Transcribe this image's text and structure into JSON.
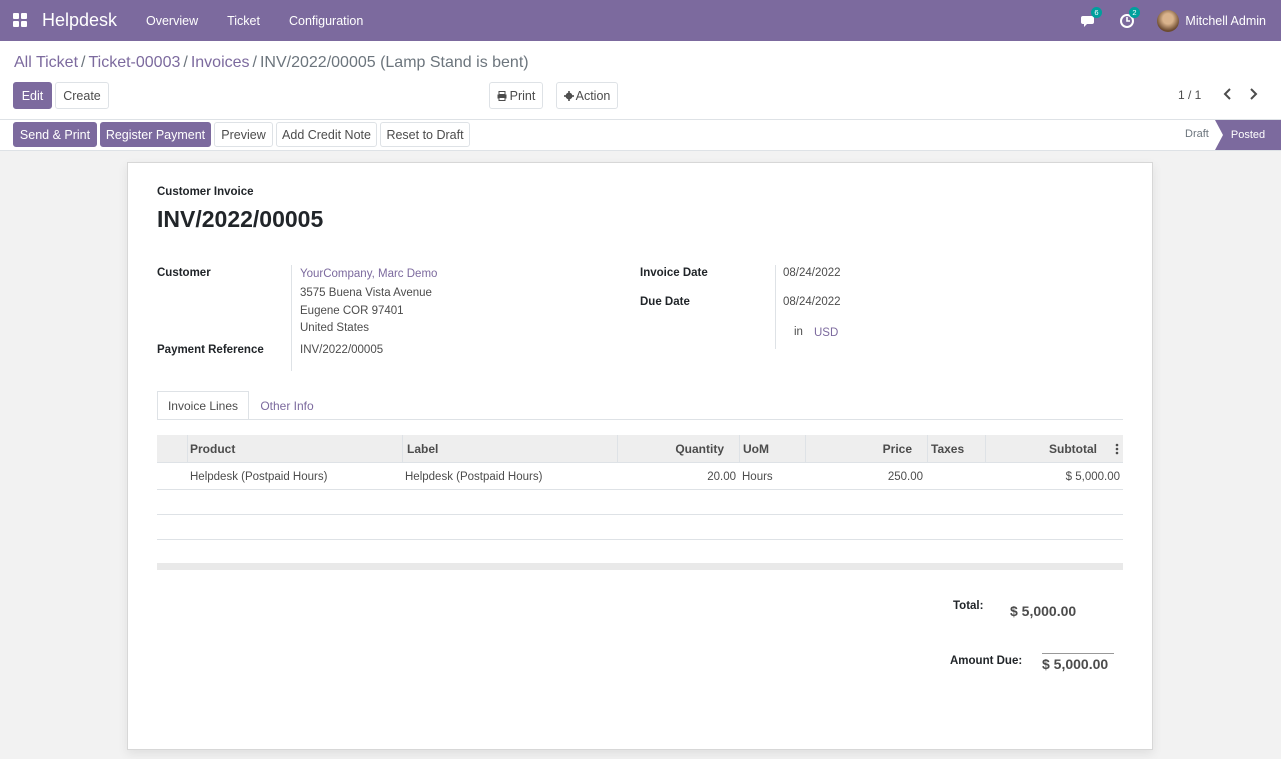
{
  "navbar": {
    "app_name": "Helpdesk",
    "menu": [
      "Overview",
      "Ticket",
      "Configuration"
    ],
    "messages_count": "6",
    "activities_count": "2",
    "user_name": "Mitchell Admin",
    "color": "#7c6a9e"
  },
  "breadcrumb": {
    "items": [
      "All Ticket",
      "Ticket-00003",
      "Invoices"
    ],
    "current": "INV/2022/00005 (Lamp Stand is bent)"
  },
  "control": {
    "edit_label": "Edit",
    "create_label": "Create",
    "print_label": "Print",
    "action_label": "Action",
    "pager": "1 / 1"
  },
  "statusbar": {
    "buttons": [
      "Send & Print",
      "Register Payment",
      "Preview",
      "Add Credit Note",
      "Reset to Draft"
    ],
    "stages": [
      "Draft",
      "Posted"
    ],
    "active_stage": "Posted"
  },
  "invoice": {
    "type_label": "Customer Invoice",
    "number": "INV/2022/00005",
    "customer_label": "Customer",
    "customer_name": "YourCompany, Marc Demo",
    "address_line1": "3575 Buena Vista Avenue",
    "address_line2": "Eugene COR 97401",
    "address_line3": "United States",
    "payment_ref_label": "Payment Reference",
    "payment_ref": "INV/2022/00005",
    "invoice_date_label": "Invoice Date",
    "invoice_date": "08/24/2022",
    "due_date_label": "Due Date",
    "due_date": "08/24/2022",
    "currency_prefix": "in",
    "currency": "USD"
  },
  "tabs": [
    "Invoice Lines",
    "Other Info"
  ],
  "lines": {
    "columns": [
      "Product",
      "Label",
      "Quantity",
      "UoM",
      "Price",
      "Taxes",
      "Subtotal"
    ],
    "rows": [
      {
        "product": "Helpdesk (Postpaid Hours)",
        "label": "Helpdesk (Postpaid Hours)",
        "quantity": "20.00",
        "uom": "Hours",
        "price": "250.00",
        "taxes": "",
        "subtotal": "$ 5,000.00"
      }
    ]
  },
  "totals": {
    "total_label": "Total:",
    "total": "$ 5,000.00",
    "amount_due_label": "Amount Due:",
    "amount_due": "$ 5,000.00"
  }
}
